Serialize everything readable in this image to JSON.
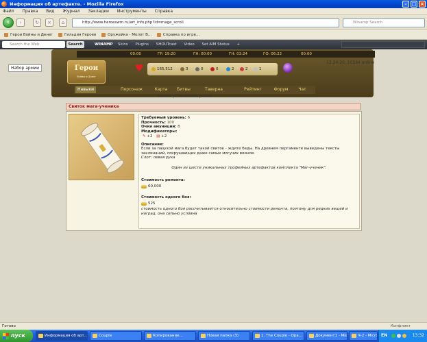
{
  "window": {
    "title": "Информация об артефакте. - Mozilla Firefox"
  },
  "menu": {
    "items": [
      "Файл",
      "Правка",
      "Вид",
      "Журнал",
      "Закладки",
      "Инструменты",
      "Справка"
    ]
  },
  "nav": {
    "url": "http://www.heroeswm.ru/art_info.php?id=mage_scroll",
    "search_placeholder": "Winamp Search"
  },
  "bookmarks": [
    "Герои Войны и Денег",
    "Гильдия Героев",
    "Оружейка - Молот В...",
    "Справка по игре..."
  ],
  "toolbar": {
    "search_placeholder": "Search the Web",
    "search_label": "Search",
    "winamp_label": "WINAMP",
    "items": [
      "Skins",
      "Plugins",
      "SHOUTcast",
      "Video",
      "Set AIM Status"
    ]
  },
  "header": {
    "times": [
      "00:00",
      "ГР: 19:20",
      "ГН: 00:00",
      "ГН: 03:24",
      "ГО: 06:22",
      "00:00"
    ],
    "logo_text": "Герои",
    "logo_sub": "Войны и Денег",
    "resources": [
      {
        "value": "165,512",
        "color": "#d8a820"
      },
      {
        "value": "3",
        "color": "#8a6a3a"
      },
      {
        "value": "0",
        "color": "#6a6a6a"
      },
      {
        "value": "0",
        "color": "#c02020"
      },
      {
        "value": "2",
        "color": "#2a8ad0"
      },
      {
        "value": "2",
        "color": "#d04040"
      },
      {
        "value": "1",
        "color": "#c0c0c0"
      }
    ],
    "datetime": "13:34:20, 10594 online",
    "tabs": [
      "Навыки",
      "Персонаж",
      "Карта",
      "Битвы",
      "Таверна",
      "Рейтинг",
      "Форум",
      "Чат"
    ],
    "army_label": "Набор армии",
    "sublinks": "Газета | Статистика рынка."
  },
  "artifact": {
    "title": "Свиток мага-ученика",
    "required_level_label": "Требуемый уровень:",
    "required_level": "6",
    "durability_label": "Прочность:",
    "durability": "100",
    "ammo_label": "Очки амуниции:",
    "ammo": "8",
    "modifiers_label": "Модификаторы:",
    "modifiers": [
      "+2",
      "+2"
    ],
    "description_label": "Описание:",
    "description": "Если за пазухой мага будет такой свиток - ждите беды. На древнем пергаменте выведены тексты заклинаний, сокрушающих даже самых могучих воинов.",
    "slot": "Слот: левая рука",
    "set_text": "Один из шести уникальных трофейных артефактов комплекта \"Маг-ученик\".",
    "repair_label": "Стоимость ремонта:",
    "repair_cost": "60,000",
    "battle_label": "Стоимость одного боя:",
    "battle_cost": "525",
    "battle_note": "стоимость одного боя рассчитывается относительно стоимости ремонта, поэтому для редких вещей и наград, она сильно условна"
  },
  "status": {
    "text": "Готово",
    "right": "Конфликт"
  },
  "taskbar": {
    "start": "пуск",
    "tasks": [
      "Информация об арт...",
      "Couple",
      "Копирование...",
      "Новая папка (3)",
      "1. The Couple - Ора...",
      "Документ1 - Micros...",
      "Ч-2 - Microsoft E..."
    ],
    "lang": "EN",
    "clock": "13:32"
  }
}
